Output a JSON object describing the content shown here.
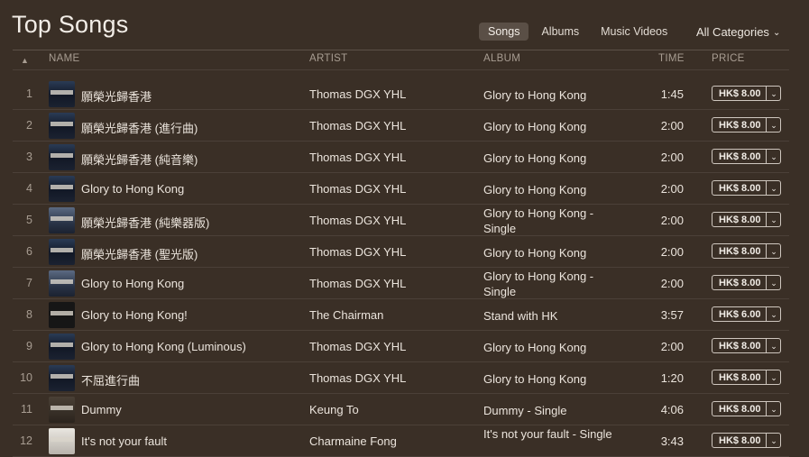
{
  "header": {
    "title": "Top Songs",
    "tabs": [
      "Songs",
      "Albums",
      "Music Videos"
    ],
    "active_tab": "Songs",
    "categories": "All Categories"
  },
  "columns": {
    "sort_icon": "▲",
    "name": "NAME",
    "artist": "ARTIST",
    "album": "ALBUM",
    "time": "TIME",
    "price": "PRICE"
  },
  "rows": [
    {
      "num": "1",
      "name": "願榮光歸香港",
      "artist": "Thomas DGX YHL",
      "album": "Glory to Hong Kong",
      "time": "1:45",
      "price": "HK$ 8.00",
      "art": "art-a"
    },
    {
      "num": "2",
      "name": "願榮光歸香港 (進行曲)",
      "artist": "Thomas DGX YHL",
      "album": "Glory to Hong Kong",
      "time": "2:00",
      "price": "HK$ 8.00",
      "art": "art-a"
    },
    {
      "num": "3",
      "name": "願榮光歸香港 (純音樂)",
      "artist": "Thomas DGX YHL",
      "album": "Glory to Hong Kong",
      "time": "2:00",
      "price": "HK$ 8.00",
      "art": "art-a"
    },
    {
      "num": "4",
      "name": "Glory to Hong Kong",
      "artist": "Thomas DGX YHL",
      "album": "Glory to Hong Kong",
      "time": "2:00",
      "price": "HK$ 8.00",
      "art": "art-a"
    },
    {
      "num": "5",
      "name": "願榮光歸香港 (純樂器版)",
      "artist": "Thomas DGX YHL",
      "album": "Glory to Hong Kong - Single",
      "time": "2:00",
      "price": "HK$ 8.00",
      "art": "art-b"
    },
    {
      "num": "6",
      "name": "願榮光歸香港 (聖光版)",
      "artist": "Thomas DGX YHL",
      "album": "Glory to Hong Kong",
      "time": "2:00",
      "price": "HK$ 8.00",
      "art": "art-a"
    },
    {
      "num": "7",
      "name": "Glory to Hong Kong",
      "artist": "Thomas DGX YHL",
      "album": "Glory to Hong Kong - Single",
      "time": "2:00",
      "price": "HK$ 8.00",
      "art": "art-b"
    },
    {
      "num": "8",
      "name": "Glory to Hong Kong!",
      "artist": "The Chairman",
      "album": "Stand with HK",
      "time": "3:57",
      "price": "HK$ 6.00",
      "art": "art-c"
    },
    {
      "num": "9",
      "name": "Glory to Hong Kong (Luminous)",
      "artist": "Thomas DGX YHL",
      "album": "Glory to Hong Kong",
      "time": "2:00",
      "price": "HK$ 8.00",
      "art": "art-a"
    },
    {
      "num": "10",
      "name": "不屈進行曲",
      "artist": "Thomas DGX YHL",
      "album": "Glory to Hong Kong",
      "time": "1:20",
      "price": "HK$ 8.00",
      "art": "art-a"
    },
    {
      "num": "11",
      "name": "Dummy",
      "artist": "Keung To",
      "album": "Dummy - Single",
      "time": "4:06",
      "price": "HK$ 8.00",
      "art": "art-d"
    },
    {
      "num": "12",
      "name": "It's not your fault",
      "artist": "Charmaine Fong",
      "album": "It's not your fault - Single",
      "time": "3:43",
      "price": "HK$ 8.00",
      "art": "art-e"
    }
  ],
  "icons": {
    "dropdown": "chevron-down-icon",
    "sort": "sort-ascending-icon"
  }
}
